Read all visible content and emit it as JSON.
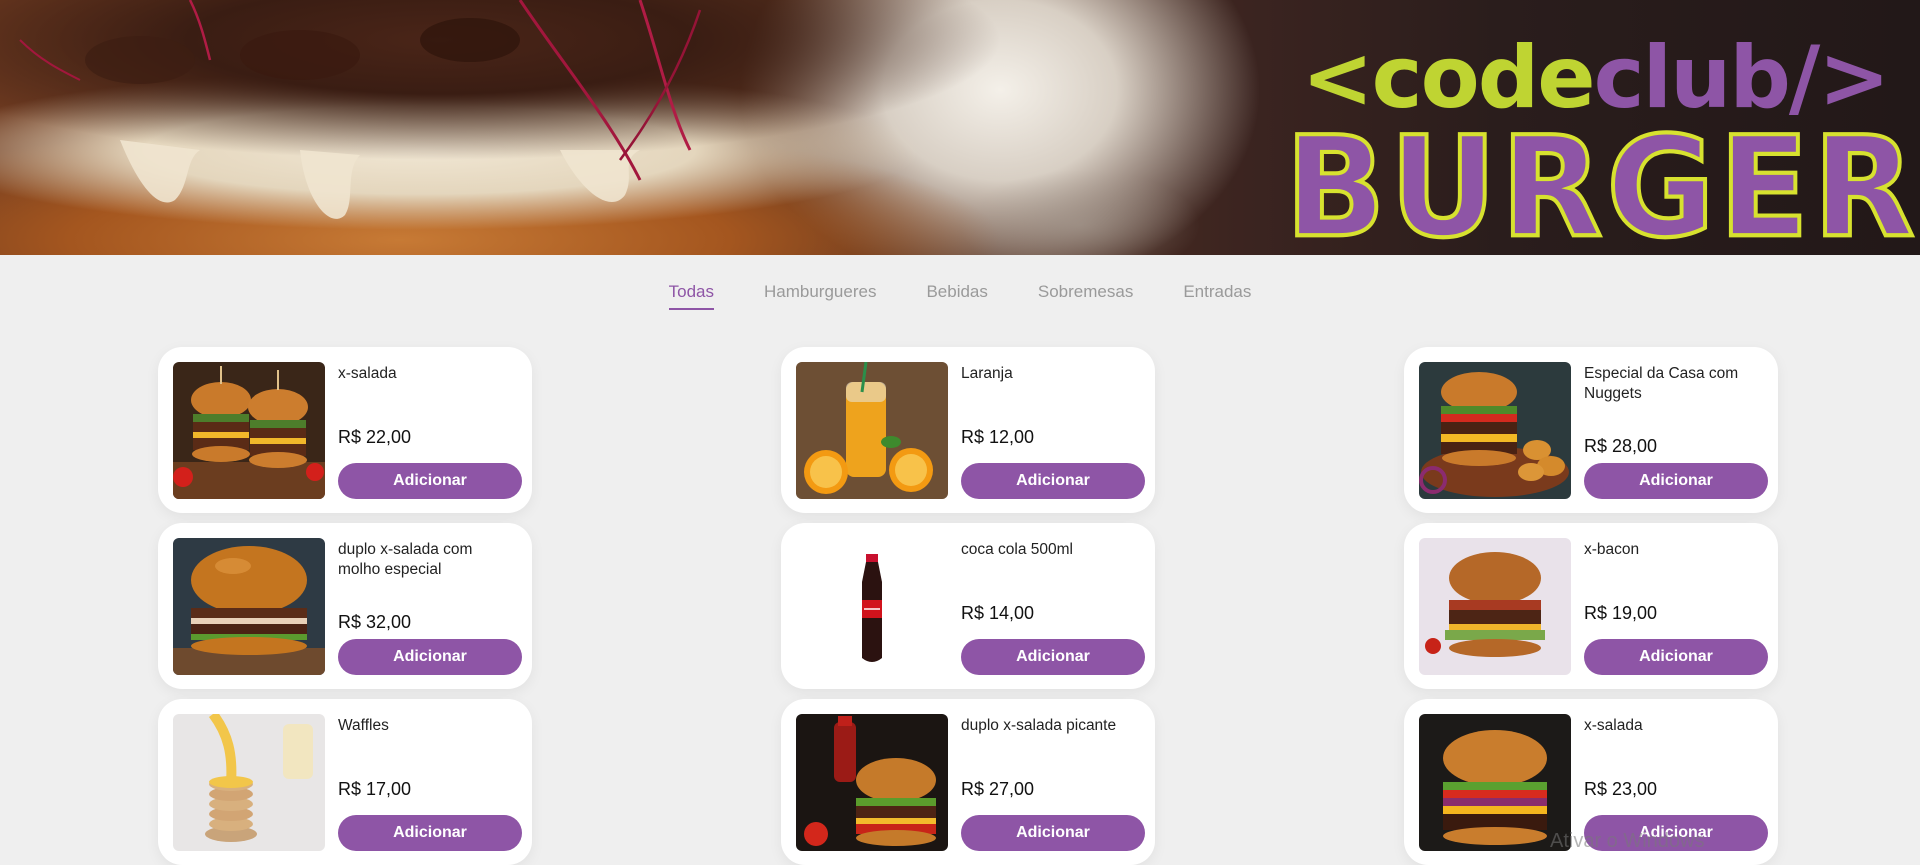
{
  "brand": {
    "logo_code_left": "<code",
    "logo_club": "club/>",
    "logo_burger": "BURGER",
    "colors": {
      "purple": "#8e55a6",
      "lime": "#bfd432",
      "background": "#efefef"
    }
  },
  "tabs": [
    {
      "label": "Todas",
      "active": true
    },
    {
      "label": "Hamburgueres",
      "active": false
    },
    {
      "label": "Bebidas",
      "active": false
    },
    {
      "label": "Sobremesas",
      "active": false
    },
    {
      "label": "Entradas",
      "active": false
    }
  ],
  "products": [
    {
      "name": "x-salada",
      "price": "R$ 22,00",
      "button": "Adicionar",
      "image": "double-burger-photo"
    },
    {
      "name": "Laranja",
      "price": "R$ 12,00",
      "button": "Adicionar",
      "image": "orange-juice-photo"
    },
    {
      "name": "Especial da Casa com Nuggets",
      "price": "R$ 28,00",
      "button": "Adicionar",
      "image": "burger-nuggets-photo"
    },
    {
      "name": "duplo x-salada com molho especial",
      "price": "R$ 32,00",
      "button": "Adicionar",
      "image": "burger-photo"
    },
    {
      "name": "coca cola 500ml",
      "price": "R$ 14,00",
      "button": "Adicionar",
      "image": "cola-bottle-photo"
    },
    {
      "name": "x-bacon",
      "price": "R$ 19,00",
      "button": "Adicionar",
      "image": "bacon-burger-photo"
    },
    {
      "name": "Waffles",
      "price": "R$ 17,00",
      "button": "Adicionar",
      "image": "waffles-photo"
    },
    {
      "name": "duplo x-salada picante",
      "price": "R$ 27,00",
      "button": "Adicionar",
      "image": "spicy-burger-photo"
    },
    {
      "name": "x-salada",
      "price": "R$ 23,00",
      "button": "Adicionar",
      "image": "cheese-burger-photo"
    }
  ],
  "watermark": "Ativar o Windows"
}
